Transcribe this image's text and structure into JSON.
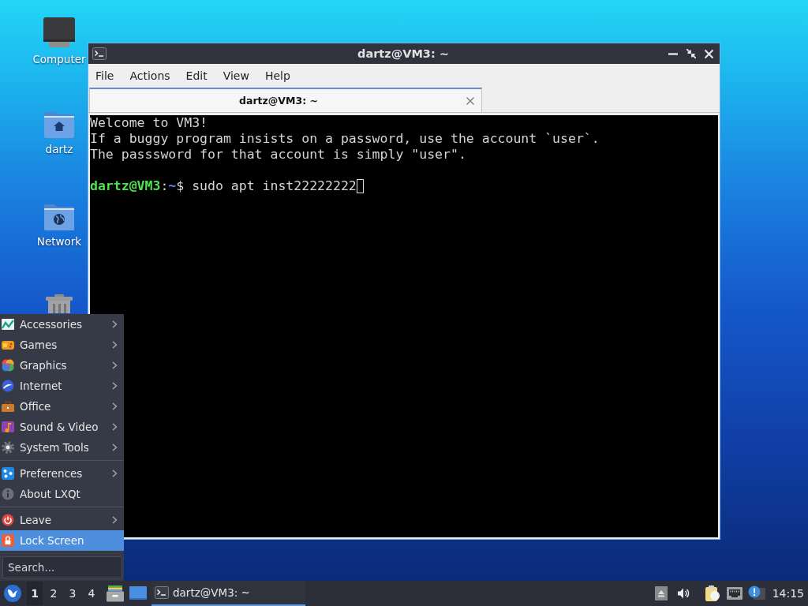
{
  "desktop": {
    "icons": [
      {
        "kind": "computer",
        "label": "Computer"
      },
      {
        "kind": "home",
        "label": "dartz"
      },
      {
        "kind": "network",
        "label": "Network"
      },
      {
        "kind": "trash"
      }
    ]
  },
  "window": {
    "title": "dartz@VM3: ~",
    "menu": [
      "File",
      "Actions",
      "Edit",
      "View",
      "Help"
    ],
    "tabs": [
      {
        "label": "dartz@VM3: ~",
        "selected": true
      }
    ],
    "terminal": {
      "lines": [
        "Welcome to VM3!",
        "If a buggy program insists on a password, use the account `user`.",
        "The passsword for that account is simply \"user\"."
      ],
      "prompt": {
        "user_host": "dartz@VM3",
        "separator": ":",
        "path": "~",
        "symbol": "$",
        "command": "sudo apt inst22222222"
      }
    }
  },
  "start_menu": {
    "groups": [
      {
        "items": [
          {
            "kind": "accessories",
            "label": "Accessories",
            "submenu": true,
            "selected": false
          },
          {
            "kind": "games",
            "label": "Games",
            "submenu": true,
            "selected": false
          },
          {
            "kind": "graphics",
            "label": "Graphics",
            "submenu": true,
            "selected": false
          },
          {
            "kind": "internet",
            "label": "Internet",
            "submenu": true,
            "selected": false
          },
          {
            "kind": "office",
            "label": "Office",
            "submenu": true,
            "selected": false
          },
          {
            "kind": "media",
            "label": "Sound & Video",
            "submenu": true,
            "selected": false
          },
          {
            "kind": "tools",
            "label": "System Tools",
            "submenu": true,
            "selected": false
          }
        ]
      },
      {
        "items": [
          {
            "kind": "preferences",
            "label": "Preferences",
            "submenu": true,
            "selected": false
          },
          {
            "kind": "about",
            "label": "About LXQt",
            "submenu": false,
            "selected": false
          }
        ]
      },
      {
        "items": [
          {
            "kind": "leave",
            "label": "Leave",
            "submenu": true,
            "selected": false
          },
          {
            "kind": "lock",
            "label": "Lock Screen",
            "submenu": false,
            "selected": true
          }
        ]
      }
    ],
    "search": {
      "placeholder": "Search..."
    }
  },
  "taskbar": {
    "desktops": [
      {
        "label": "1",
        "selected": true
      },
      {
        "label": "2",
        "selected": false
      },
      {
        "label": "3",
        "selected": false
      },
      {
        "label": "4",
        "selected": false
      }
    ],
    "quick_launch": [
      {
        "kind": "file-manager"
      },
      {
        "kind": "show-desktop"
      }
    ],
    "tasks": [
      {
        "label": "dartz@VM3: ~",
        "selected": true
      }
    ],
    "tray": [
      {
        "kind": "eject"
      },
      {
        "kind": "volume"
      },
      {
        "kind": "clipboard"
      },
      {
        "kind": "network"
      },
      {
        "kind": "notification"
      }
    ],
    "clock": "14:15"
  }
}
